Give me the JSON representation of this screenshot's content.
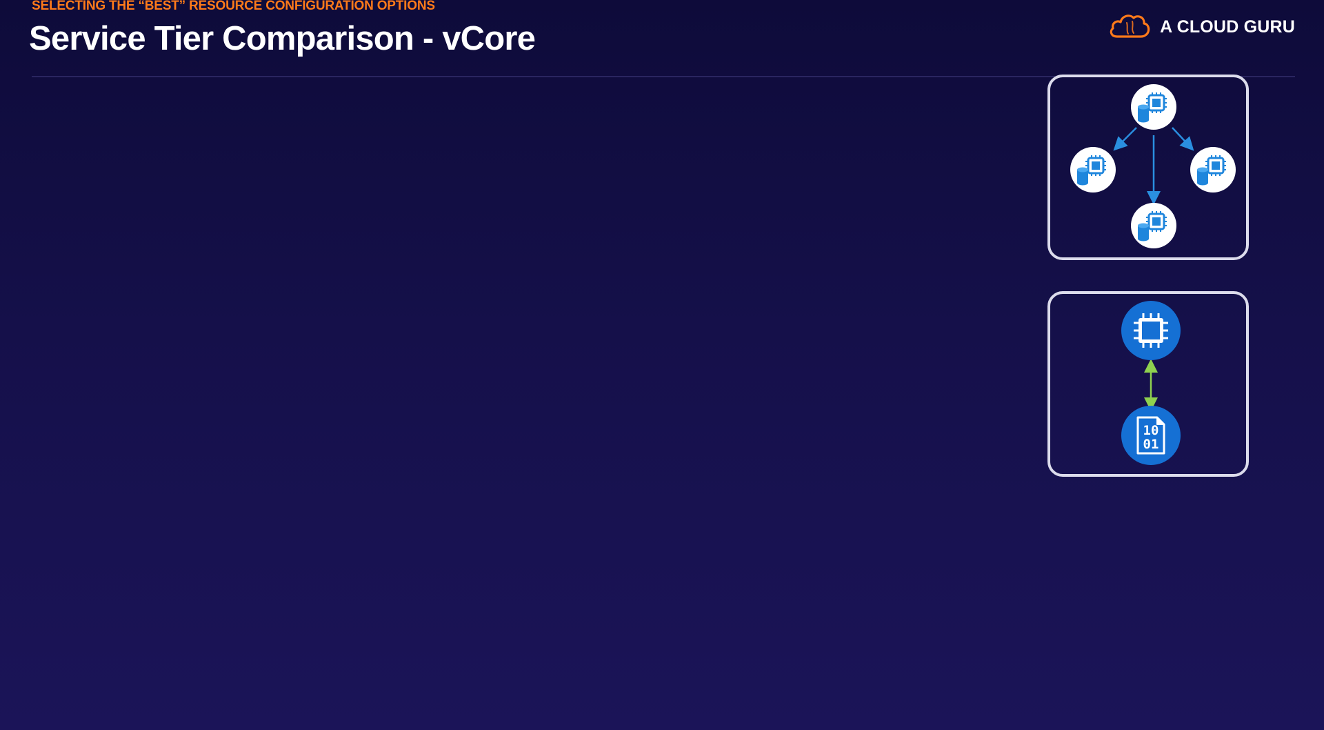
{
  "slide": {
    "eyebrow": "SELECTING THE “BEST” RESOURCE CONFIGURATION OPTIONS",
    "title": "Service Tier Comparison - vCore"
  },
  "brand": {
    "name": "A CLOUD GURU",
    "logo_icon": "cloud-logo-icon",
    "accent_color": "#ff7a1a"
  },
  "diagram_top": {
    "nodes": [
      "primary-replica",
      "secondary-replica-left",
      "secondary-replica-right",
      "secondary-replica-bottom"
    ],
    "icon": "database-processor-icon",
    "arrow_color": "#2a8fe0"
  },
  "diagram_bottom": {
    "compute_icon": "processor-chip-icon",
    "storage_icon": "binary-file-icon",
    "storage_text_line1": "10",
    "storage_text_line2": "01",
    "node_color": "#1570d4",
    "link_color": "#8fd14f"
  },
  "colors": {
    "background": "#15104a",
    "panel_border": "#dcdcec"
  }
}
